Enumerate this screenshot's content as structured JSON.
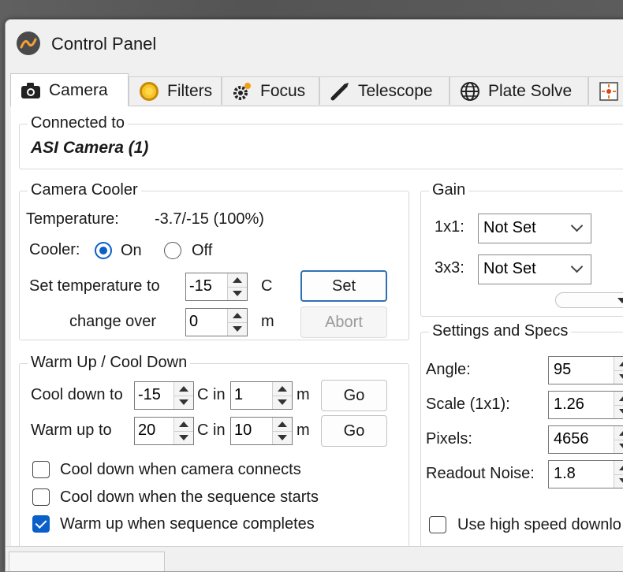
{
  "window": {
    "title": "Control Panel"
  },
  "tabs": [
    {
      "label": "Camera",
      "icon": "camera-icon",
      "active": true
    },
    {
      "label": "Filters",
      "icon": "filter-wheel-icon"
    },
    {
      "label": "Focus",
      "icon": "focus-gears-icon"
    },
    {
      "label": "Telescope",
      "icon": "telescope-icon"
    },
    {
      "label": "Plate Solve",
      "icon": "globe-icon"
    },
    {
      "label": "",
      "icon": "target-icon"
    }
  ],
  "connected": {
    "legend": "Connected to",
    "device": "ASI Camera (1)"
  },
  "cooler": {
    "legend": "Camera Cooler",
    "temperature_label": "Temperature:",
    "temperature_value": "-3.7/-15 (100%)",
    "cooler_label": "Cooler:",
    "on_label": "On",
    "off_label": "Off",
    "set_temp_label": "Set temperature to",
    "set_temp_value": "-15",
    "set_temp_unit": "C",
    "change_over_label": "change over",
    "change_over_value": "0",
    "change_over_unit": "m",
    "set_button": "Set",
    "abort_button": "Abort"
  },
  "warm": {
    "legend": "Warm Up / Cool Down",
    "cool_label": "Cool down to",
    "cool_temp": "-15",
    "cool_unit": "C in",
    "cool_minutes": "1",
    "cool_min_unit": "m",
    "cool_go": "Go",
    "warm_label": "Warm up to",
    "warm_temp": "20",
    "warm_unit": "C in",
    "warm_minutes": "10",
    "warm_min_unit": "m",
    "warm_go": "Go",
    "chk_connect": "Cool down when camera connects",
    "chk_sequence_start": "Cool down when the sequence starts",
    "chk_sequence_complete": "Warm up when sequence completes"
  },
  "gain": {
    "legend": "Gain",
    "label_1x1": "1x1:",
    "value_1x1": "Not Set",
    "label_3x3": "3x3:",
    "value_3x3": "Not Set"
  },
  "specs": {
    "legend": "Settings and Specs",
    "angle_label": "Angle:",
    "angle_value": "95",
    "scale_label": "Scale (1x1):",
    "scale_value": "1.26",
    "pixels_label": "Pixels:",
    "pixels_value": "4656",
    "noise_label": "Readout Noise:",
    "noise_value": "1.8",
    "high_speed_label": "Use high speed downlo"
  },
  "colors": {
    "accent": "#0a60c8",
    "primary_border": "#2f6fb3"
  }
}
